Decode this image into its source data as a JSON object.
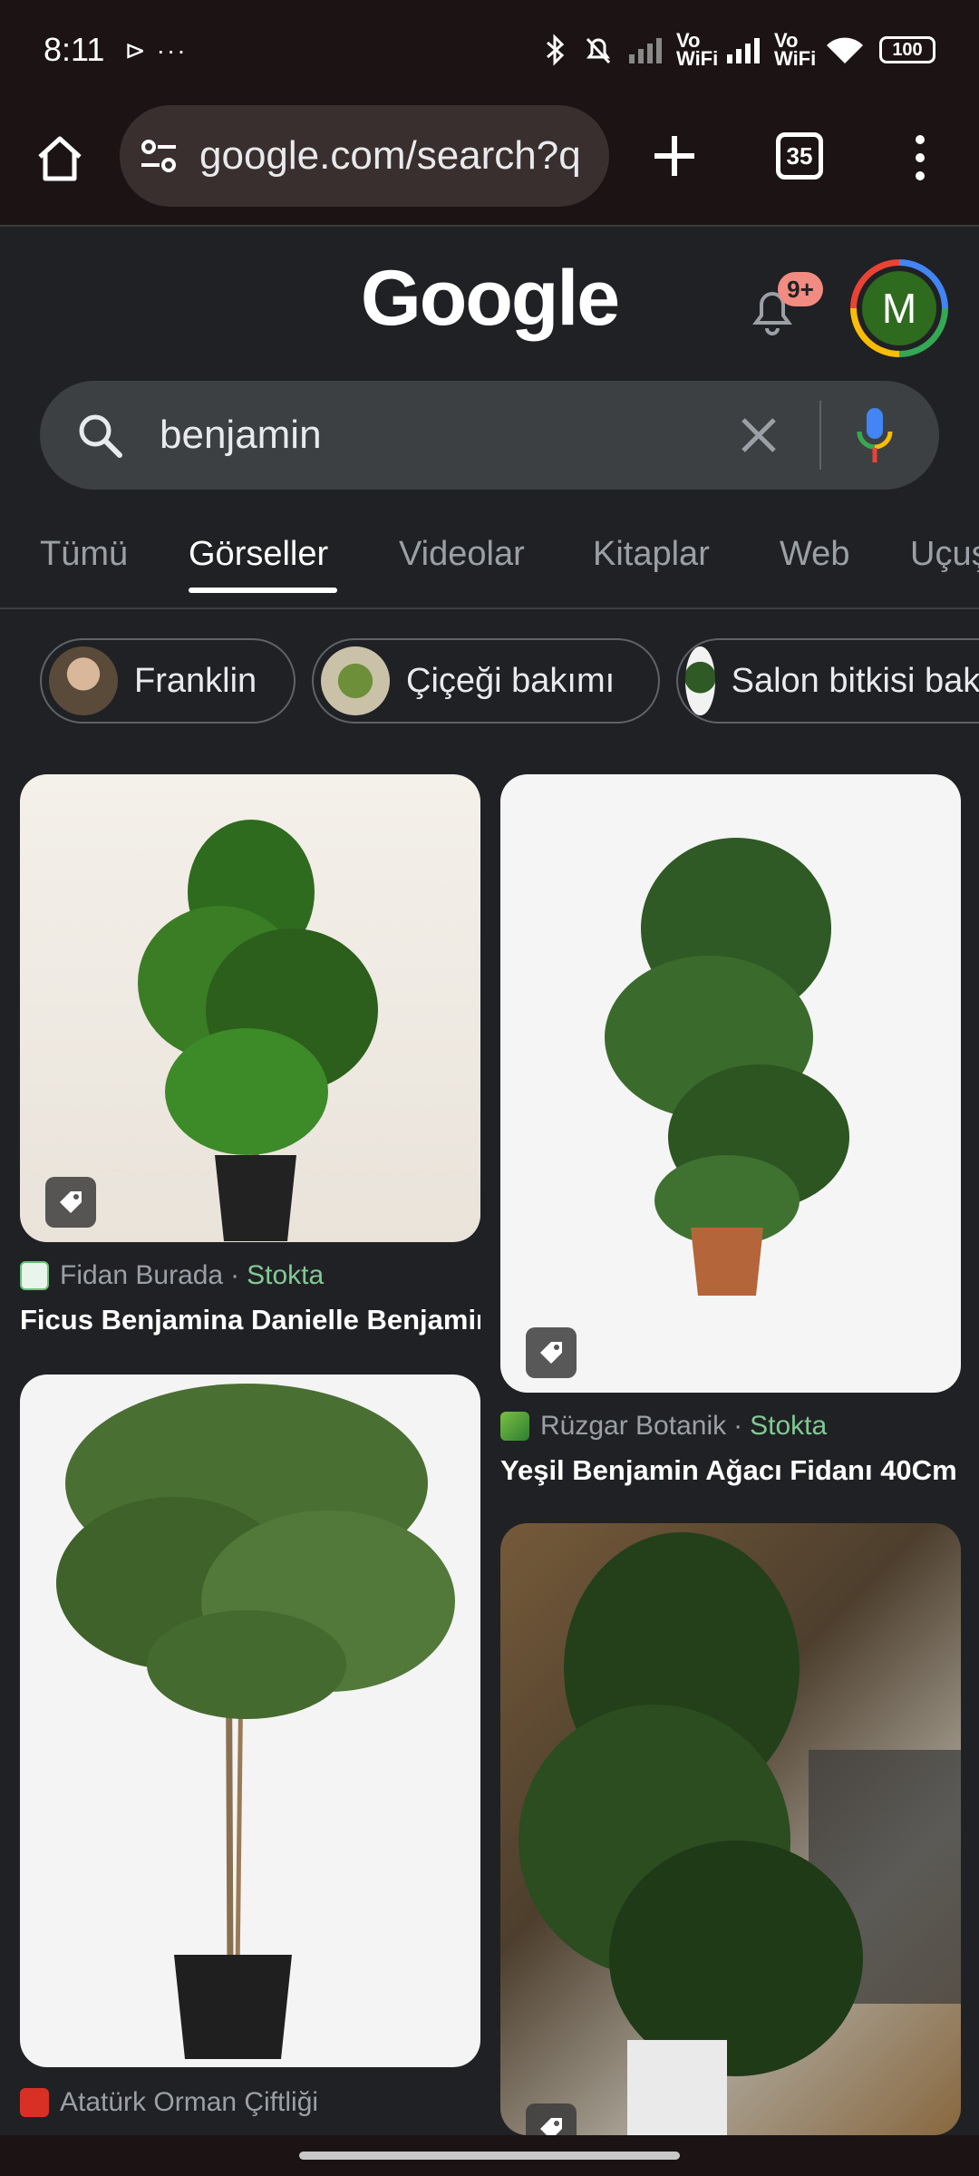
{
  "status_bar": {
    "time": "8:11",
    "extra": "⊳ ···",
    "vowifi_1": "Vo WiFi",
    "vowifi_2": "Vo WiFi",
    "battery": "100"
  },
  "browser": {
    "url": "google.com/search?q",
    "tab_count": "35"
  },
  "google": {
    "logo": "Google",
    "notification_badge": "9+",
    "avatar_letter": "M"
  },
  "search": {
    "query": "benjamin"
  },
  "tabs": [
    "Tümü",
    "Görseller",
    "Videolar",
    "Kitaplar",
    "Web",
    "Uçuşlar"
  ],
  "chips": [
    "Franklin",
    "Çiçeği bakımı",
    "Salon bitkisi bakımı"
  ],
  "results": [
    {
      "source": "Fidan Burada",
      "stock": "Stokta",
      "title": "Ficus Benjamina Danielle Benjamin Ağacı"
    },
    {
      "source": "Rüzgar Botanik",
      "stock": "Stokta",
      "title": "Yeşil Benjamin Ağacı Fidanı 40Cm"
    },
    {
      "source": "Atatürk Orman Çiftliği",
      "stock": "",
      "title": ""
    },
    {
      "source": "",
      "stock": "",
      "title": ""
    }
  ],
  "colors": {
    "background": "#202124",
    "stock_green": "#81c995",
    "badge": "#f28b82"
  }
}
